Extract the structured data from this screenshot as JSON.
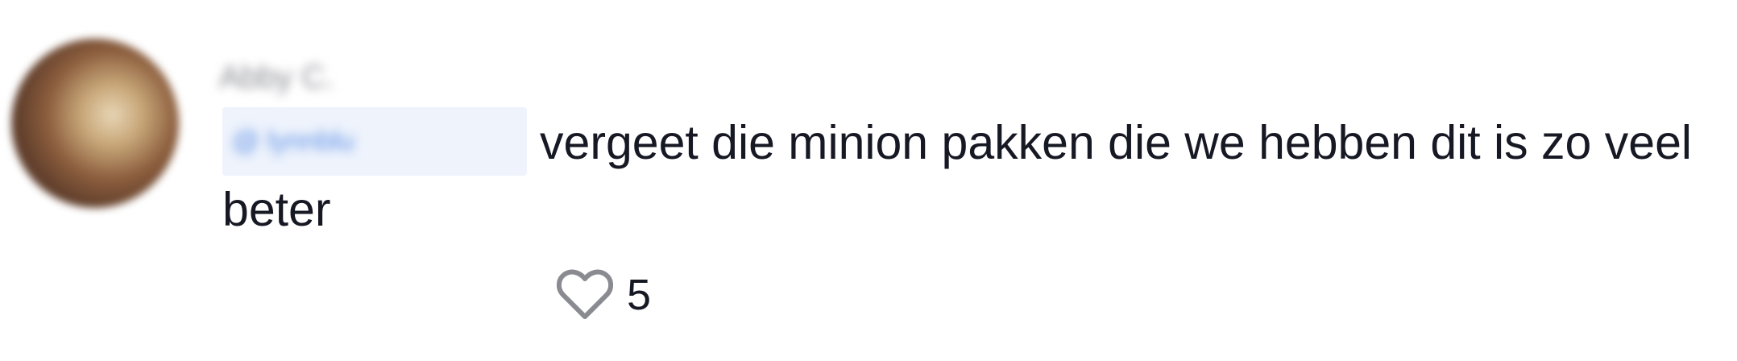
{
  "comment": {
    "username": "Abby C.",
    "mention": "@ lynnblu",
    "text": "vergeet die minion pakken die we hebben dit is zo veel beter",
    "like_count": "5"
  },
  "icons": {
    "like": "heart-outline-icon"
  },
  "colors": {
    "text": "#161823",
    "muted": "#8a8b91",
    "mention_bg": "#eef3fc",
    "mention_text": "#5d8fe6",
    "icon": "#8a8b91"
  }
}
